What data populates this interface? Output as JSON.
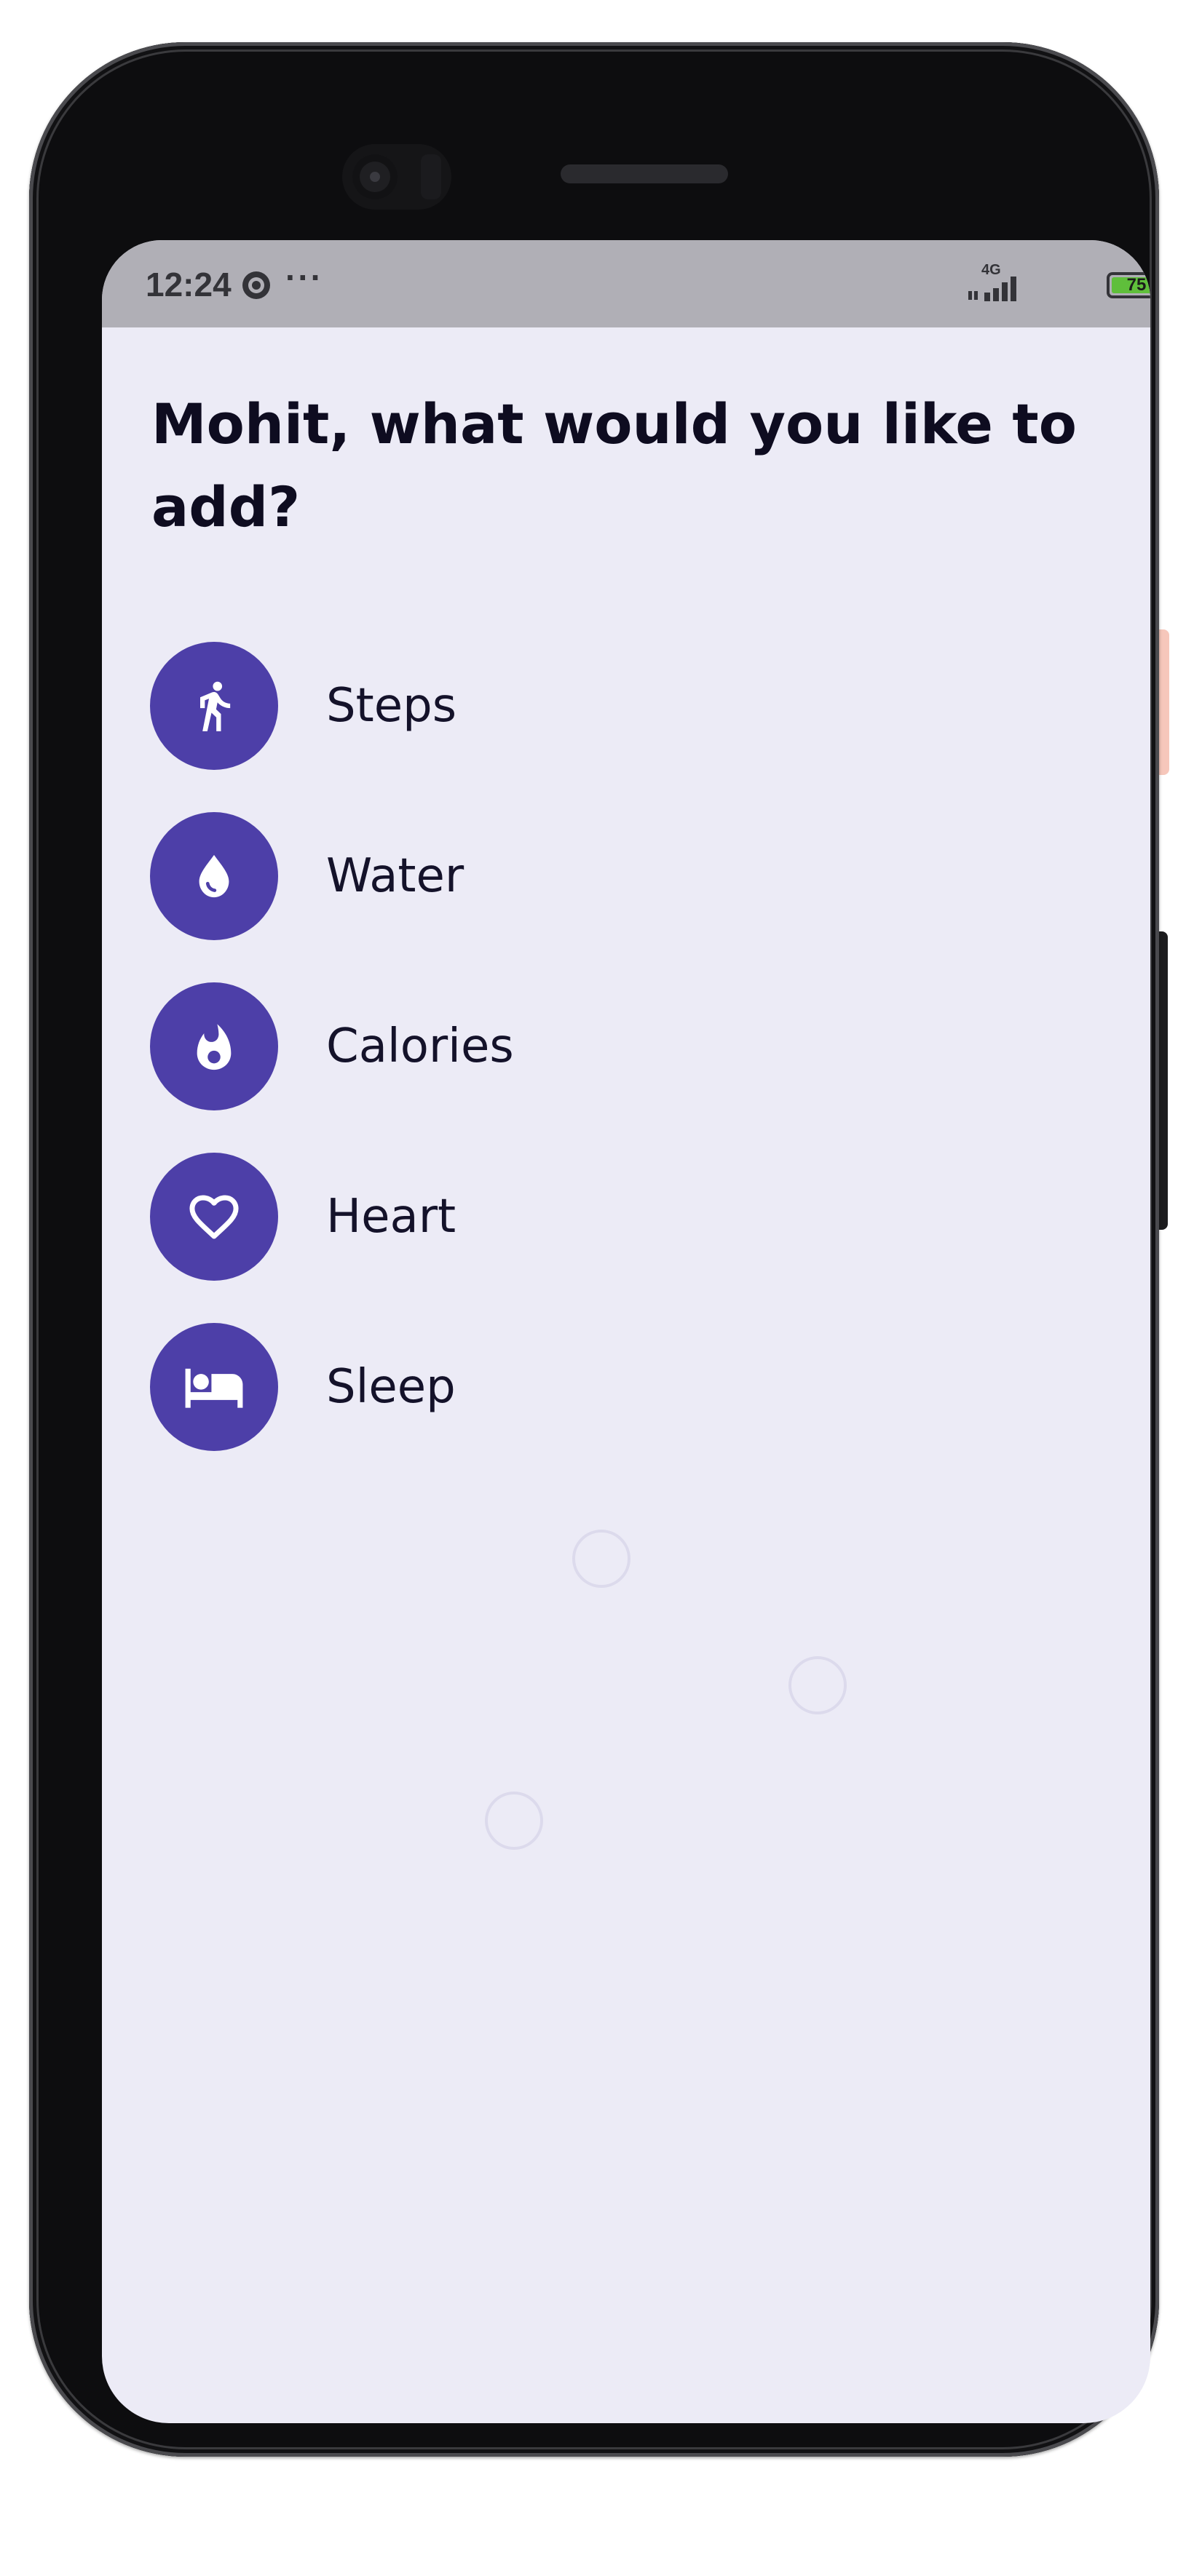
{
  "status_bar": {
    "time": "12:24",
    "overflow": "···",
    "network": "4G",
    "battery": "75",
    "icons": [
      "screen-record-icon",
      "signal-icon",
      "battery-icon"
    ]
  },
  "page": {
    "title": "Mohit, what would you like to add?"
  },
  "options": [
    {
      "label": "Steps",
      "icon": "running-person-icon"
    },
    {
      "label": "Water",
      "icon": "water-drop-icon"
    },
    {
      "label": "Calories",
      "icon": "flame-icon"
    },
    {
      "label": "Heart",
      "icon": "heart-icon"
    },
    {
      "label": "Sleep",
      "icon": "bed-icon"
    }
  ],
  "colors": {
    "accent": "#4d3fa8",
    "background": "#ecebf6",
    "text": "#0e0c20",
    "status_bar": "#b0afb6",
    "battery_fill": "#5fbf3b"
  }
}
